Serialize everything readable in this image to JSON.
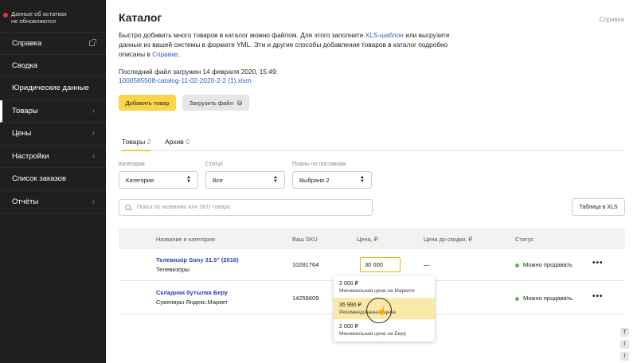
{
  "sidebar": {
    "status_text": "Данные об остатках не обновляются",
    "items": [
      {
        "label": "Справка"
      },
      {
        "label": "Сводка"
      },
      {
        "label": "Юридические данные"
      },
      {
        "label": "Товары"
      },
      {
        "label": "Цены"
      },
      {
        "label": "Настройки"
      },
      {
        "label": "Список заказов"
      },
      {
        "label": "Отчёты"
      }
    ]
  },
  "header": {
    "title": "Каталог",
    "help_link": "Справка",
    "intro_1": "Быстро добавить много товаров в каталог можно файлом. Для этого заполните ",
    "intro_link1": "XLS-шаблон",
    "intro_2": " или выгрузите данные из вашей системы в формате YML. Эти и другие способы добавления товаров в каталог подробно описаны в ",
    "intro_link2": "Справке",
    "intro_3": ".",
    "last_file_label": "Последний файл загружен 14 февраля 2020, 15:49:",
    "last_file_name": "1000585508-catalog-11-02-2020-2-2 (1).xlsm"
  },
  "actions": {
    "add_product": "Добавить товар",
    "upload_file": "Загрузить файл"
  },
  "tabs": [
    {
      "label": "Товары",
      "count": "2"
    },
    {
      "label": "Архив",
      "count": "0"
    }
  ],
  "filters": {
    "category": {
      "label": "Категория",
      "value": "Категория"
    },
    "status": {
      "label": "Статус",
      "value": "Все"
    },
    "plans": {
      "label": "Планы по поставкам",
      "value": "Выбрано 2"
    }
  },
  "search": {
    "placeholder": "Поиск по названию или SKU товара"
  },
  "xls_button": "Таблица в XLS",
  "table": {
    "columns": [
      "Название и категория",
      "Ваш SKU",
      "Цена, ₽",
      "Цена до скидки, ₽",
      "Статус"
    ],
    "rows": [
      {
        "name": "Телевизор Sony 31.5\" (2016)",
        "category": "Телевизоры",
        "sku": "10281764",
        "price": "30 000",
        "old_price": "—",
        "status": "Можно продавать"
      },
      {
        "name": "Складная бутылка Беру",
        "category": "Сувениры Яндекс.Маркет",
        "sku": "14259609",
        "price": "",
        "old_price": "",
        "status": "Можно продавать"
      }
    ]
  },
  "price_dropdown": [
    {
      "price": "2 000 ₽",
      "desc": "Минимальная цена на Маркете"
    },
    {
      "price": "35 990 ₽",
      "desc": "Рекомендованная цена"
    },
    {
      "price": "2 000 ₽",
      "desc": "Минимальная цена на Беру"
    }
  ],
  "side_buttons": [
    "T",
    "I",
    "I"
  ],
  "colors": {
    "accent": "#f8d54a",
    "link": "#2f5dc3",
    "sidebar": "#1f1f1f",
    "status_ok": "#5dbb4a",
    "alert": "#e53935"
  }
}
